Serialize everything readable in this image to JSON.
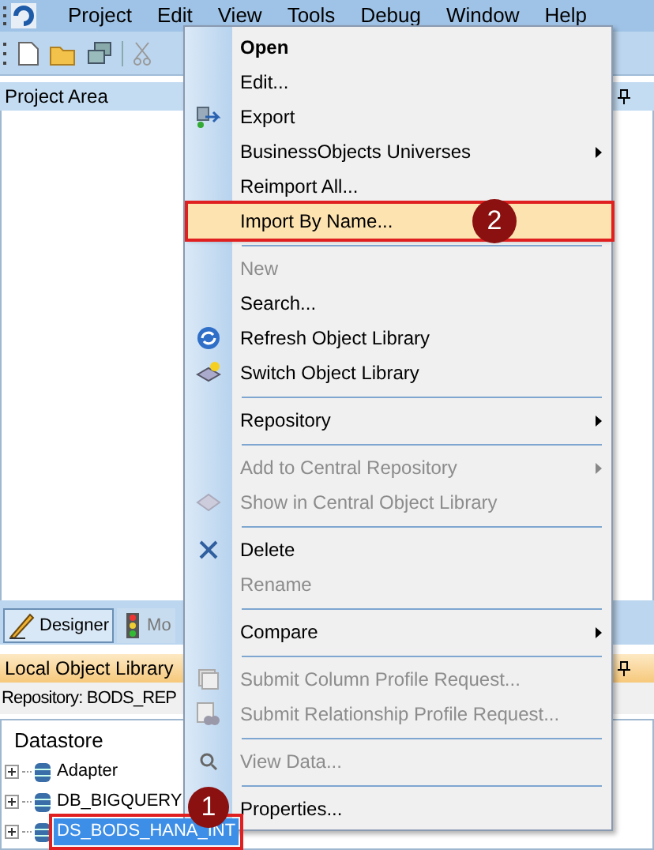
{
  "menu_bar": {
    "items": [
      "Project",
      "Edit",
      "View",
      "Tools",
      "Debug",
      "Window",
      "Help"
    ]
  },
  "project_area": {
    "title": "Project Area"
  },
  "tabs": [
    {
      "label": "Designer",
      "selected": true
    },
    {
      "label": "Mo",
      "selected": false
    }
  ],
  "local_object_library": {
    "title": "Local Object Library",
    "repository": "Repository: BODS_REP",
    "tree": {
      "label": "Datastore",
      "children": [
        {
          "label": "Adapter",
          "selected": false
        },
        {
          "label": "DB_BIGQUERY",
          "selected": false
        },
        {
          "label": "DS_BODS_HANA_INT",
          "selected": true
        }
      ]
    }
  },
  "context_menu": {
    "items": [
      {
        "kind": "item",
        "label": "Open",
        "bold": true,
        "disabled": false,
        "submenu": false,
        "highlighted": false
      },
      {
        "kind": "item",
        "label": "Edit...",
        "bold": false,
        "disabled": false,
        "submenu": false,
        "highlighted": false
      },
      {
        "kind": "item",
        "label": "Export",
        "bold": false,
        "disabled": false,
        "submenu": false,
        "highlighted": false
      },
      {
        "kind": "item",
        "label": "BusinessObjects Universes",
        "bold": false,
        "disabled": false,
        "submenu": true,
        "highlighted": false
      },
      {
        "kind": "item",
        "label": "Reimport All...",
        "bold": false,
        "disabled": false,
        "submenu": false,
        "highlighted": false
      },
      {
        "kind": "item",
        "label": "Import By Name...",
        "bold": false,
        "disabled": false,
        "submenu": false,
        "highlighted": true,
        "callout": "2"
      },
      {
        "kind": "separator"
      },
      {
        "kind": "item",
        "label": "New",
        "bold": false,
        "disabled": true,
        "submenu": false,
        "highlighted": false
      },
      {
        "kind": "item",
        "label": "Search...",
        "bold": false,
        "disabled": false,
        "submenu": false,
        "highlighted": false
      },
      {
        "kind": "item",
        "label": "Refresh Object Library",
        "bold": false,
        "disabled": false,
        "submenu": false,
        "highlighted": false
      },
      {
        "kind": "item",
        "label": "Switch Object Library",
        "bold": false,
        "disabled": false,
        "submenu": false,
        "highlighted": false
      },
      {
        "kind": "separator"
      },
      {
        "kind": "item",
        "label": "Repository",
        "bold": false,
        "disabled": false,
        "submenu": true,
        "highlighted": false
      },
      {
        "kind": "separator"
      },
      {
        "kind": "item",
        "label": "Add to Central Repository",
        "bold": false,
        "disabled": true,
        "submenu": true,
        "highlighted": false
      },
      {
        "kind": "item",
        "label": "Show in Central Object Library",
        "bold": false,
        "disabled": true,
        "submenu": false,
        "highlighted": false
      },
      {
        "kind": "separator"
      },
      {
        "kind": "item",
        "label": "Delete",
        "bold": false,
        "disabled": false,
        "submenu": false,
        "highlighted": false
      },
      {
        "kind": "item",
        "label": "Rename",
        "bold": false,
        "disabled": true,
        "submenu": false,
        "highlighted": false
      },
      {
        "kind": "separator"
      },
      {
        "kind": "item",
        "label": "Compare",
        "bold": false,
        "disabled": false,
        "submenu": true,
        "highlighted": false
      },
      {
        "kind": "separator"
      },
      {
        "kind": "item",
        "label": "Submit Column Profile Request...",
        "bold": false,
        "disabled": true,
        "submenu": false,
        "highlighted": false
      },
      {
        "kind": "item",
        "label": "Submit Relationship Profile Request...",
        "bold": false,
        "disabled": true,
        "submenu": false,
        "highlighted": false
      },
      {
        "kind": "separator"
      },
      {
        "kind": "item",
        "label": "View Data...",
        "bold": false,
        "disabled": true,
        "submenu": false,
        "highlighted": false
      },
      {
        "kind": "separator"
      },
      {
        "kind": "item",
        "label": "Properties...",
        "bold": false,
        "disabled": false,
        "submenu": false,
        "highlighted": false
      }
    ]
  },
  "selected_callout": "1"
}
